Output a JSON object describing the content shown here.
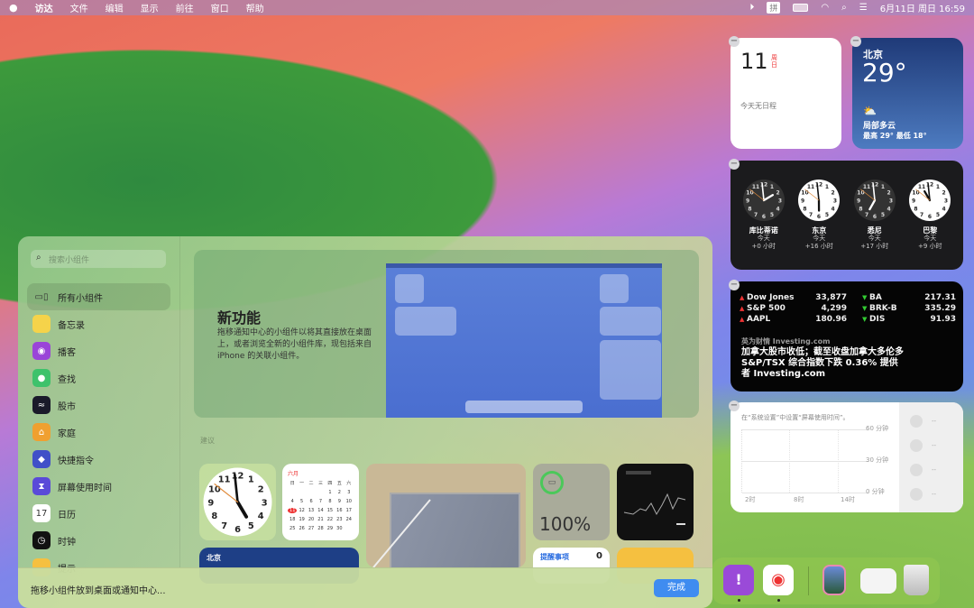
{
  "menubar": {
    "apple": "",
    "items": [
      "访达",
      "文件",
      "编辑",
      "显示",
      "前往",
      "窗口",
      "帮助"
    ],
    "input_method": "拼",
    "datetime": "6月11日 周日  16:59"
  },
  "calendar_widget": {
    "day": "11",
    "weekday": "周日",
    "events": "今天无日程"
  },
  "weather_widget": {
    "city": "北京",
    "temp": "29°",
    "condition": "局部多云",
    "range": "最高 29° 最低 18°"
  },
  "world_clock": [
    {
      "city": "库比蒂诺",
      "day": "今天",
      "offset": "+0 小时",
      "hour": 1,
      "minute": 59,
      "dark": true
    },
    {
      "city": "东京",
      "day": "今天",
      "offset": "+16 小时",
      "hour": 5,
      "minute": 59,
      "dark": false
    },
    {
      "city": "悉尼",
      "day": "今天",
      "offset": "+17 小时",
      "hour": 6,
      "minute": 59,
      "dark": true
    },
    {
      "city": "巴黎",
      "day": "今天",
      "offset": "+9 小时",
      "hour": 10,
      "minute": 59,
      "dark": false
    }
  ],
  "stocks": {
    "left": [
      {
        "name": "Dow Jones",
        "value": "33,877",
        "dir": "up"
      },
      {
        "name": "S&P 500",
        "value": "4,299",
        "dir": "up"
      },
      {
        "name": "AAPL",
        "value": "180.96",
        "dir": "up"
      }
    ],
    "right": [
      {
        "name": "BA",
        "value": "217.31",
        "dir": "down"
      },
      {
        "name": "BRK-B",
        "value": "335.29",
        "dir": "down"
      },
      {
        "name": "DIS",
        "value": "91.93",
        "dir": "down"
      }
    ],
    "source": "英为财情 Investing.com",
    "headline": "加拿大股市收低；截至收盘加拿大多伦多 S&P/TSX 综合指数下跌 0.36% 提供者 Investing.com"
  },
  "screen_time": {
    "note": "在“系统设置”中设置“屏幕使用时间”。",
    "y_labels": [
      "60 分钟",
      "30 分钟",
      "0 分钟"
    ],
    "x_labels": [
      "2时",
      "8时",
      "14时"
    ],
    "placeholder": "--"
  },
  "gallery": {
    "search_placeholder": "搜索小组件",
    "sidebar": [
      {
        "label": "所有小组件",
        "color": "transparent",
        "glyph": "▭▯"
      },
      {
        "label": "备忘录",
        "color": "#f5d34a",
        "glyph": ""
      },
      {
        "label": "播客",
        "color": "#9a45d8",
        "glyph": "◉"
      },
      {
        "label": "查找",
        "color": "#3ec26b",
        "glyph": "●"
      },
      {
        "label": "股市",
        "color": "#1a1a2a",
        "glyph": "≈"
      },
      {
        "label": "家庭",
        "color": "#f0a030",
        "glyph": "⌂"
      },
      {
        "label": "快捷指令",
        "color": "#4050c8",
        "glyph": "◆"
      },
      {
        "label": "屏幕使用时间",
        "color": "#5a4ad8",
        "glyph": "⧗"
      },
      {
        "label": "日历",
        "color": "#ffffff",
        "glyph": "17"
      },
      {
        "label": "时钟",
        "color": "#111111",
        "glyph": "◷"
      },
      {
        "label": "提示",
        "color": "#f5c040",
        "glyph": ""
      }
    ],
    "hero_title": "新功能",
    "hero_text": "拖移通知中心的小组件以将其直接放在桌面上，或者浏览全新的小组件库，现包括来自 iPhone 的关联小组件。",
    "section_label": "建议",
    "mini_cal_month": "六月",
    "mini_cal_weekdays": [
      "日",
      "一",
      "二",
      "三",
      "四",
      "五",
      "六"
    ],
    "mini_weather_city": "北京",
    "battery": "100%",
    "reminders_title": "提醒事项",
    "reminders_count": "0",
    "footer_text": "拖移小组件放到桌面或通知中心...",
    "done": "完成"
  },
  "dock": {
    "items": [
      "反馈助理",
      "微博",
      "预览",
      "备忘录",
      "废纸篓"
    ]
  }
}
